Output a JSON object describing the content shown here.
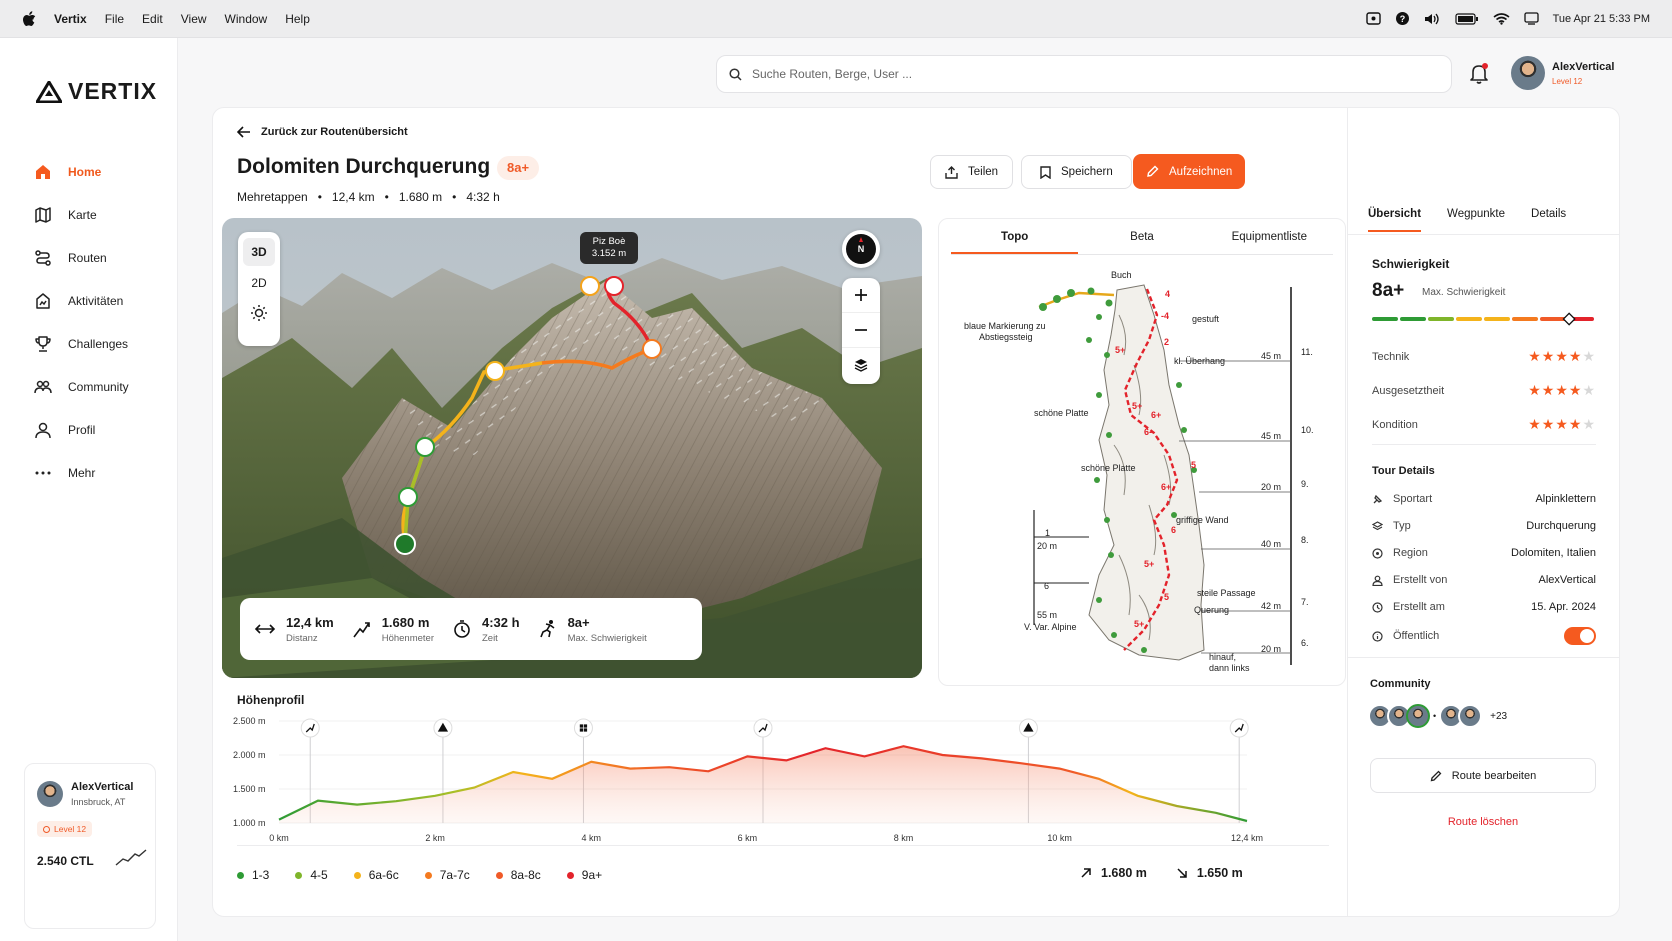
{
  "menubar": {
    "app": "Vertix",
    "menus": [
      "File",
      "Edit",
      "View",
      "Window",
      "Help"
    ],
    "datetime": "Tue Apr 21  5:33 PM"
  },
  "brand": {
    "name": "VERTIX",
    "accent": "#f55a1f"
  },
  "nav": [
    {
      "label": "Home",
      "icon": "home-icon",
      "active": true
    },
    {
      "label": "Karte",
      "icon": "map-icon"
    },
    {
      "label": "Routen",
      "icon": "route-icon"
    },
    {
      "label": "Aktivitäten",
      "icon": "activity-icon"
    },
    {
      "label": "Challenges",
      "icon": "trophy-icon"
    },
    {
      "label": "Community",
      "icon": "community-icon"
    },
    {
      "label": "Profil",
      "icon": "profile-icon"
    },
    {
      "label": "Mehr",
      "icon": "more-icon"
    }
  ],
  "usercard": {
    "name": "AlexVertical",
    "location": "Innsbruck, AT",
    "level": "Level 12",
    "ctl": "2.540 CTL"
  },
  "search": {
    "placeholder": "Suche Routen, Berge, User ..."
  },
  "header_user": {
    "name": "AlexVertical",
    "level": "Level 12"
  },
  "route": {
    "back": "Zurück zur Routenübersicht",
    "title": "Dolomiten Durchquerung",
    "grade": "8a+",
    "meta": [
      "Mehretappen",
      "12,4 km",
      "1.680 m",
      "4:32 h"
    ]
  },
  "actions": {
    "share": "Teilen",
    "save": "Speichern",
    "record": "Aufzeichnen"
  },
  "map": {
    "modes": [
      "3D",
      "2D"
    ],
    "compass": "N",
    "summit_name": "Piz Boè",
    "summit_height": "3.152 m",
    "stats": [
      {
        "value": "12,4 km",
        "label": "Distanz",
        "icon": "distance-icon"
      },
      {
        "value": "1.680 m",
        "label": "Höhenmeter",
        "icon": "elevation-icon"
      },
      {
        "value": "4:32 h",
        "label": "Zeit",
        "icon": "timer-icon"
      },
      {
        "value": "8a+",
        "label": "Max. Schwierigkeit",
        "icon": "climber-icon"
      }
    ]
  },
  "topo": {
    "tabs": [
      "Topo",
      "Beta",
      "Equipmentliste"
    ],
    "labels": {
      "buch": "Buch",
      "blau1": "blaue Markierung zu",
      "blau2": "Abstiegssteig",
      "gestuft": "gestuft",
      "ueberhang": "kl. Überhang",
      "platte1": "schöne Platte",
      "platte2": "schöne Platte",
      "wand": "griffige Wand",
      "passage": "steile Passage",
      "querung": "Querung",
      "hinauf1": "hinauf,",
      "hinauf2": "dann links",
      "one": "1",
      "six": "6",
      "m20": "20 m",
      "m55": "55 m",
      "var": "V. Var. Alpine"
    },
    "grades": [
      "4",
      "-4",
      "2",
      "5+",
      "5+",
      "6+",
      "5",
      "6-",
      "6+",
      "6",
      "5+",
      "5",
      "5+"
    ],
    "pitches": [
      {
        "len": "45 m",
        "num": "11."
      },
      {
        "len": "45 m",
        "num": "10."
      },
      {
        "len": "20 m",
        "num": "9."
      },
      {
        "len": "40 m",
        "num": "8."
      },
      {
        "len": "42 m",
        "num": "7."
      },
      {
        "len": "20 m",
        "num": "6."
      }
    ]
  },
  "panel": {
    "tabs": [
      "Übersicht",
      "Wegpunkte",
      "Details"
    ],
    "difficulty_title": "Schwierigkeit",
    "difficulty_value": "8a+",
    "difficulty_sub": "Max. Schwierigkeit",
    "difficulty_level": 0.88,
    "ratings": [
      {
        "label": "Technik",
        "stars": 4
      },
      {
        "label": "Ausgesetztheit",
        "stars": 4
      },
      {
        "label": "Kondition",
        "stars": 4
      }
    ],
    "tour_title": "Tour Details",
    "details": [
      {
        "label": "Sportart",
        "value": "Alpinklettern",
        "icon": "pin-icon"
      },
      {
        "label": "Typ",
        "value": "Durchquerung",
        "icon": "layers-icon"
      },
      {
        "label": "Region",
        "value": "Dolomiten, Italien",
        "icon": "location-icon"
      },
      {
        "label": "Erstellt von",
        "value": "AlexVertical",
        "icon": "user-icon"
      },
      {
        "label": "Erstellt am",
        "value": "15. Apr. 2024",
        "icon": "clock-icon"
      },
      {
        "label": "Öffentlich",
        "icon": "info-icon",
        "toggle": true
      }
    ],
    "community_title": "Community",
    "community_more": "+23",
    "edit": "Route bearbeiten",
    "delete": "Route löschen"
  },
  "profile": {
    "title": "Höhenprofil",
    "yticks": [
      "2.500 m",
      "2.000 m",
      "1.500 m",
      "1.000 m"
    ],
    "xticks": [
      "0 km",
      "2 km",
      "4 km",
      "6 km",
      "8 km",
      "10 km",
      "12,4 km"
    ],
    "ascent": "1.680 m",
    "descent": "1.650 m"
  },
  "chart_data": {
    "type": "area",
    "title": "Höhenprofil",
    "x": [
      0,
      0.5,
      1,
      1.5,
      2,
      2.5,
      3,
      3.5,
      4,
      4.5,
      5,
      5.5,
      6,
      6.5,
      7,
      7.5,
      8,
      8.5,
      9,
      9.5,
      10,
      10.5,
      11,
      11.5,
      12,
      12.4
    ],
    "y": [
      1050,
      1330,
      1270,
      1320,
      1400,
      1520,
      1750,
      1650,
      1900,
      1800,
      1820,
      1760,
      1980,
      1920,
      2100,
      1980,
      2130,
      2000,
      1950,
      1880,
      1800,
      1650,
      1400,
      1250,
      1150,
      1030
    ],
    "xlim": [
      0,
      12.4
    ],
    "ylim": [
      1000,
      2500
    ],
    "legend": [
      "1-3",
      "4-5",
      "6a-6c",
      "7a-7c",
      "8a-8c",
      "9a+"
    ],
    "legend_colors": [
      "#2e9b35",
      "#7fb52a",
      "#f4b31b",
      "#f47a1f",
      "#f05a28",
      "#e3232b"
    ]
  }
}
